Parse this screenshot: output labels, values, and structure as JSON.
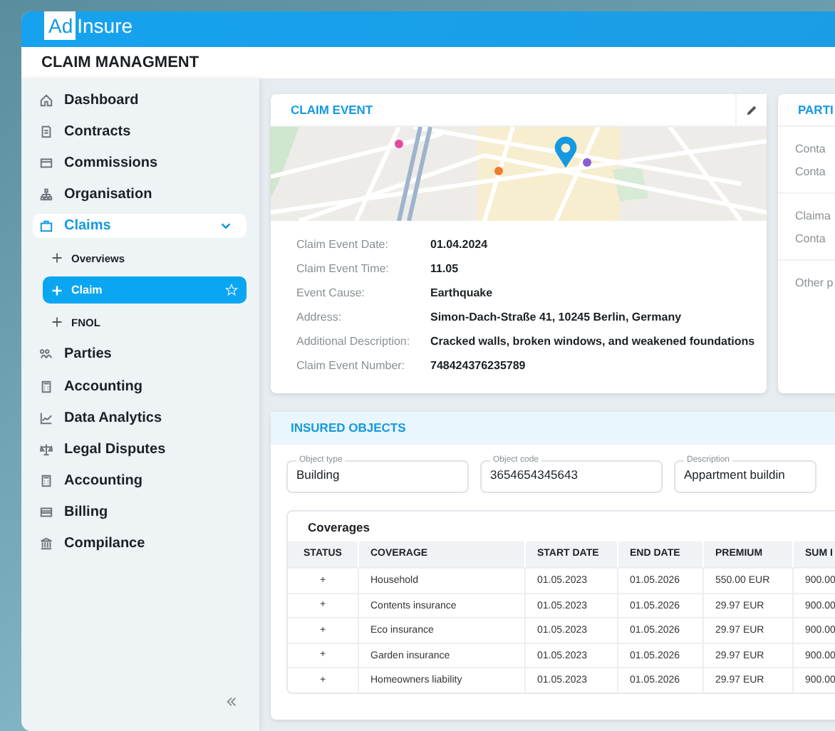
{
  "app": {
    "logo_prefix": "Ad",
    "logo_suffix": "Insure"
  },
  "page_title": "CLAIM MANAGMENT",
  "sidebar": {
    "items": [
      {
        "label": "Dashboard",
        "selected": false
      },
      {
        "label": "Contracts",
        "selected": false
      },
      {
        "label": "Commissions",
        "selected": false
      },
      {
        "label": "Organisation",
        "selected": false
      },
      {
        "label": "Claims",
        "selected": true,
        "expanded": true,
        "children": [
          {
            "label": "Overviews",
            "selected": false
          },
          {
            "label": "Claim",
            "selected": true
          },
          {
            "label": "FNOL",
            "selected": false
          }
        ]
      },
      {
        "label": "Parties",
        "selected": false
      },
      {
        "label": "Accounting",
        "selected": false
      },
      {
        "label": "Data Analytics",
        "selected": false
      },
      {
        "label": "Legal Disputes",
        "selected": false
      },
      {
        "label": "Accounting",
        "selected": false
      },
      {
        "label": "Billing",
        "selected": false
      },
      {
        "label": "Compilance",
        "selected": false
      }
    ]
  },
  "claim_event": {
    "title": "CLAIM EVENT",
    "details": [
      {
        "label": "Claim Event Date:",
        "value": "01.04.2024"
      },
      {
        "label": "Claim Event Time:",
        "value": "11.05"
      },
      {
        "label": "Event Cause:",
        "value": "Earthquake"
      },
      {
        "label": "Address:",
        "value": "Simon-Dach-Straße 41, 10245 Berlin, Germany"
      },
      {
        "label": "Additional Description:",
        "value": "Cracked walls, broken windows, and weakened foundations"
      },
      {
        "label": "Claim Event Number:",
        "value": "748424376235789"
      }
    ]
  },
  "parties": {
    "title": "PARTI",
    "groups": [
      {
        "lines": [
          "Conta",
          "Conta"
        ]
      },
      {
        "lines": [
          "Claima",
          "Conta"
        ]
      },
      {
        "lines": [
          "Other p"
        ]
      }
    ]
  },
  "insured_objects": {
    "title": "INSURED OBJECTS",
    "fields": [
      {
        "label": "Object type",
        "value": "Building"
      },
      {
        "label": "Object code",
        "value": "3654654345643"
      },
      {
        "label": "Description",
        "value": "Appartment buildin"
      }
    ],
    "coverages": {
      "title": "Coverages",
      "columns": [
        "STATUS",
        "COVERAGE",
        "START DATE",
        "END DATE",
        "PREMIUM",
        "SUM I"
      ],
      "rows": [
        {
          "cells": [
            "+",
            "Household",
            "01.05.2023",
            "01.05.2026",
            "550.00 EUR",
            "900.00"
          ]
        },
        {
          "cells": [
            "+",
            "Contents insurance",
            "01.05.2023",
            "01.05.2026",
            "29.97 EUR",
            "900.00"
          ]
        },
        {
          "cells": [
            "+",
            "Eco insurance",
            "01.05.2023",
            "01.05.2026",
            "29.97 EUR",
            "900.00"
          ]
        },
        {
          "cells": [
            "+",
            "Garden insurance",
            "01.05.2023",
            "01.05.2026",
            "29.97 EUR",
            "900.00"
          ]
        },
        {
          "cells": [
            "+",
            "Homeowners liability",
            "01.05.2023",
            "01.05.2026",
            "29.97 EUR",
            "900.00"
          ]
        }
      ]
    }
  }
}
